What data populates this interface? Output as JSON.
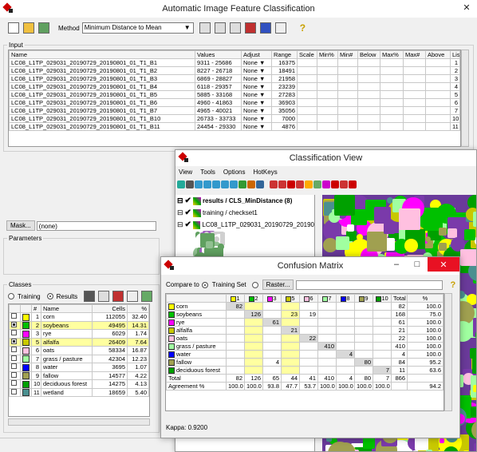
{
  "main": {
    "title": "Automatic Image Feature Classification",
    "method_label": "Method",
    "method_value": "Minimum Distance to Mean",
    "input_legend": "Input",
    "input_headers": [
      "Name",
      "Values",
      "Adjust",
      "Range",
      "Scale",
      "Min%",
      "Min#",
      "Below",
      "Max%",
      "Max#",
      "Above",
      "List"
    ],
    "bands": [
      {
        "name": "LC08_L1TP_029031_20190729_20190801_01_T1_B1",
        "values": "9311 - 25686",
        "adjust": "None",
        "range": "16375",
        "list": "1"
      },
      {
        "name": "LC08_L1TP_029031_20190729_20190801_01_T1_B2",
        "values": "8227 - 26718",
        "adjust": "None",
        "range": "18491",
        "list": "2"
      },
      {
        "name": "LC08_L1TP_029031_20190729_20190801_01_T1_B3",
        "values": "6869 - 28827",
        "adjust": "None",
        "range": "21958",
        "list": "3"
      },
      {
        "name": "LC08_L1TP_029031_20190729_20190801_01_T1_B4",
        "values": "6118 - 29357",
        "adjust": "None",
        "range": "23239",
        "list": "4"
      },
      {
        "name": "LC08_L1TP_029031_20190729_20190801_01_T1_B5",
        "values": "5885 - 33168",
        "adjust": "None",
        "range": "27283",
        "list": "5"
      },
      {
        "name": "LC08_L1TP_029031_20190729_20190801_01_T1_B6",
        "values": "4960 - 41863",
        "adjust": "None",
        "range": "36903",
        "list": "6"
      },
      {
        "name": "LC08_L1TP_029031_20190729_20190801_01_T1_B7",
        "values": "4965 - 40021",
        "adjust": "None",
        "range": "35056",
        "list": "7"
      },
      {
        "name": "LC08_L1TP_029031_20190729_20190801_01_T1_B10",
        "values": "26733 - 33733",
        "adjust": "None",
        "range": "7000",
        "list": "10"
      },
      {
        "name": "LC08_L1TP_029031_20190729_20190801_01_T1_B11",
        "values": "24454 - 29330",
        "adjust": "None",
        "range": "4876",
        "list": "11"
      }
    ],
    "mask_button": "Mask...",
    "mask_value": "(none)",
    "parameters_legend": "Parameters",
    "classes_legend": "Classes",
    "training_label": "Training",
    "results_label": "Results",
    "class_headers": [
      "#",
      "Name",
      "Cells",
      "%"
    ],
    "classes": [
      {
        "num": "1",
        "name": "corn",
        "cells": "112055",
        "pct": "32.40",
        "color": "#ffff00",
        "checked": false,
        "hl": false
      },
      {
        "num": "2",
        "name": "soybeans",
        "cells": "49495",
        "pct": "14.31",
        "color": "#00c000",
        "checked": true,
        "hl": true
      },
      {
        "num": "3",
        "name": "rye",
        "cells": "6029",
        "pct": "1.74",
        "color": "#ff00ff",
        "checked": false,
        "hl": false
      },
      {
        "num": "5",
        "name": "alfalfa",
        "cells": "26409",
        "pct": "7.64",
        "color": "#c8c800",
        "checked": true,
        "hl": true
      },
      {
        "num": "6",
        "name": "oats",
        "cells": "58334",
        "pct": "16.87",
        "color": "#ffc0e0",
        "checked": false,
        "hl": false
      },
      {
        "num": "7",
        "name": "grass / pasture",
        "cells": "42304",
        "pct": "12.23",
        "color": "#a0ffa0",
        "checked": false,
        "hl": false
      },
      {
        "num": "8",
        "name": "water",
        "cells": "3695",
        "pct": "1.07",
        "color": "#0000ff",
        "checked": false,
        "hl": false
      },
      {
        "num": "9",
        "name": "fallow",
        "cells": "14577",
        "pct": "4.22",
        "color": "#a0a050",
        "checked": false,
        "hl": false
      },
      {
        "num": "10",
        "name": "deciduous forest",
        "cells": "14275",
        "pct": "4.13",
        "color": "#00a000",
        "checked": false,
        "hl": false
      },
      {
        "num": "11",
        "name": "wetland",
        "cells": "18659",
        "pct": "5.40",
        "color": "#4a9090",
        "checked": false,
        "hl": false
      }
    ]
  },
  "view": {
    "title": "Classification View",
    "menu": [
      "View",
      "Tools",
      "Options",
      "HotKeys"
    ],
    "layers": [
      "results / CLS_MinDistance (8)",
      "training / checkset1",
      "LC08_L1TP_029031_20190729_20190"
    ]
  },
  "cm": {
    "title": "Confusion Matrix",
    "compare_label": "Compare to",
    "training_set_label": "Training Set",
    "raster_button": "Raster...",
    "col_headers": [
      "1",
      "2",
      "3",
      "5",
      "6",
      "7",
      "8",
      "9",
      "10",
      "Total",
      "%"
    ],
    "col_colors": [
      "#ffff00",
      "#00c000",
      "#ff00ff",
      "#c8c800",
      "#ffc0e0",
      "#a0ffa0",
      "#0000ff",
      "#a0a050",
      "#00a000"
    ],
    "rows": [
      {
        "name": "corn",
        "color": "#ffff00",
        "cells": [
          "82",
          "",
          "",
          "",
          "",
          "",
          "",
          "",
          "",
          "82",
          "100.0"
        ]
      },
      {
        "name": "soybeans",
        "color": "#00c000",
        "cells": [
          "",
          "126",
          "",
          "23",
          "19",
          "",
          "",
          "",
          "",
          "168",
          "75.0"
        ]
      },
      {
        "name": "rye",
        "color": "#ff00ff",
        "cells": [
          "",
          "",
          "61",
          "",
          "",
          "",
          "",
          "",
          "",
          "61",
          "100.0"
        ]
      },
      {
        "name": "alfalfa",
        "color": "#c8c800",
        "cells": [
          "",
          "",
          "",
          "21",
          "",
          "",
          "",
          "",
          "",
          "21",
          "100.0"
        ]
      },
      {
        "name": "oats",
        "color": "#ffc0e0",
        "cells": [
          "",
          "",
          "",
          "",
          "22",
          "",
          "",
          "",
          "",
          "22",
          "100.0"
        ]
      },
      {
        "name": "grass / pasture",
        "color": "#a0ffa0",
        "cells": [
          "",
          "",
          "",
          "",
          "",
          "410",
          "",
          "",
          "",
          "410",
          "100.0"
        ]
      },
      {
        "name": "water",
        "color": "#0000ff",
        "cells": [
          "",
          "",
          "",
          "",
          "",
          "",
          "4",
          "",
          "",
          "4",
          "100.0"
        ]
      },
      {
        "name": "fallow",
        "color": "#a0a050",
        "cells": [
          "",
          "",
          "4",
          "",
          "",
          "",
          "",
          "80",
          "",
          "84",
          "95.2"
        ]
      },
      {
        "name": "deciduous forest",
        "color": "#00a000",
        "cells": [
          "",
          "",
          "",
          "",
          "",
          "",
          "",
          "",
          "7",
          "11",
          "63.6"
        ]
      }
    ],
    "total_label": "Total",
    "totals": [
      "82",
      "126",
      "65",
      "44",
      "41",
      "410",
      "4",
      "80",
      "7",
      "866",
      ""
    ],
    "agreement_label": "Agreement %",
    "agreement": [
      "100.0",
      "100.0",
      "93.8",
      "47.7",
      "53.7",
      "100.0",
      "100.0",
      "100.0",
      "100.0",
      "",
      "94.2"
    ],
    "kappa": "Kappa: 0.9200"
  }
}
